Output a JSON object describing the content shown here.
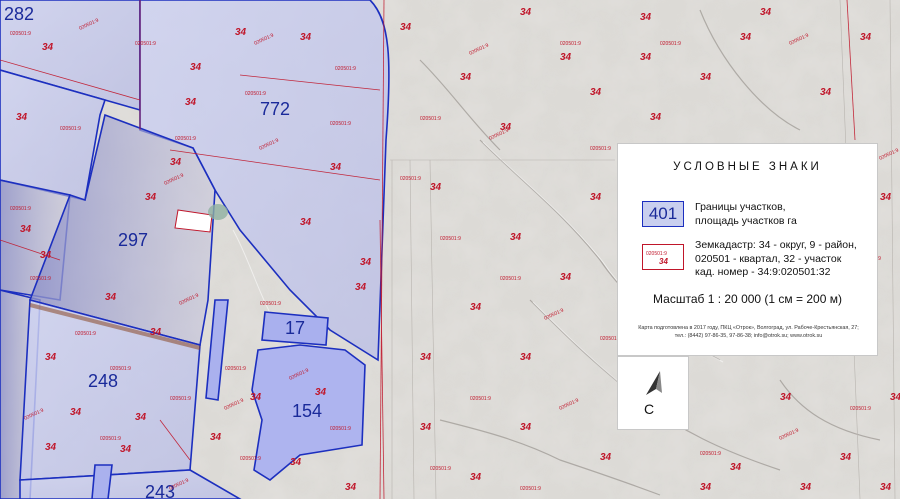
{
  "parcels": [
    {
      "id": "p282",
      "label": "282"
    },
    {
      "id": "p772",
      "label": "772"
    },
    {
      "id": "p297",
      "label": "297"
    },
    {
      "id": "p17",
      "label": "17"
    },
    {
      "id": "p248",
      "label": "248"
    },
    {
      "id": "p154",
      "label": "154"
    },
    {
      "id": "p243",
      "label": "243"
    }
  ],
  "district_code": "34",
  "cadastral_number": "020501:9",
  "legend": {
    "title": "УСЛОВНЫЕ ЗНАКИ",
    "parcel_sample": "401",
    "parcel_text_1": "Границы участков,",
    "parcel_text_2": "площадь участков га",
    "cad_line_1": "Земкадастр: 34 - округ, 9 - район,",
    "cad_line_2": "020501 - квартал, 32 - участок",
    "cad_line_3": "кад. номер - 34:9:020501:32",
    "scale": "Масштаб 1 : 20 000  (1 см = 200 м)",
    "footer_1": "Карта подготовлена в 2017 году, ПКЦ «Отрок», Волгоград, ул. Рабоче-Крестьянская, 27;",
    "footer_2": "тел.: (8442) 97-86-35, 97-86-38; info@otrok.su; www.otrok.su"
  },
  "north": {
    "letter": "С"
  },
  "colors": {
    "parcel_border": "#1c2fbf",
    "parcel_fill": "#c9cfef",
    "cadastre": "#c0162a",
    "terrain": "#d9d6d2"
  }
}
